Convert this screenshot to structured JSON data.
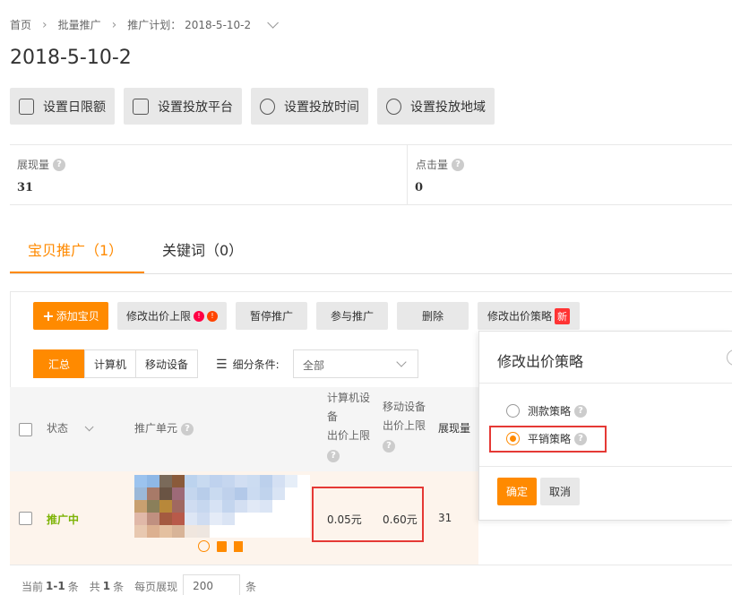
{
  "breadcrumb": {
    "home": "首页",
    "batch": "批量推广",
    "plan": "推广计划： 2018-5-10-2"
  },
  "page_title": "2018-5-10-2",
  "toolbar": {
    "daily_limit": "设置日限额",
    "platform": "设置投放平台",
    "time": "设置投放时间",
    "region": "设置投放地域"
  },
  "stats": {
    "impressions_label": "展现量",
    "impressions_value": "31",
    "clicks_label": "点击量",
    "clicks_value": "0"
  },
  "tabs": {
    "items": "宝贝推广（1）",
    "keywords": "关键词（0）"
  },
  "actions": {
    "add": "添加宝贝",
    "modify_bid": "修改出价上限",
    "pause": "暂停推广",
    "join": "参与推广",
    "delete": "删除",
    "bid_strategy": "修改出价策略",
    "new_badge": "新"
  },
  "segments": {
    "summary": "汇总",
    "computer": "计算机",
    "mobile": "移动设备"
  },
  "filter": {
    "label": "细分条件:",
    "value": "全部"
  },
  "table": {
    "col_status": "状态",
    "col_unit": "推广单元",
    "col_pc_bid_1": "计算机设",
    "col_pc_bid_2": "备",
    "col_pc_bid_3": "出价上限",
    "col_mobile_bid_1": "移动设备",
    "col_mobile_bid_2": "出价上限",
    "col_impressions": "展现量",
    "row": {
      "status": "推广中",
      "pc_bid": "0.05元",
      "mobile_bid": "0.60元",
      "impressions": "31"
    }
  },
  "footer": {
    "current": "当前",
    "range": "1-1",
    "unit1": "条",
    "total_label": "共",
    "total": "1",
    "unit2": "条",
    "per_page_label": "每页展现",
    "per_page": "200",
    "unit3": "条"
  },
  "popup": {
    "title": "修改出价策略",
    "option1": "测款策略",
    "option2": "平销策略",
    "confirm": "确定",
    "cancel": "取消"
  },
  "colors": {
    "accent": "#ff8a00",
    "status_green": "#7cb305",
    "highlight_red": "#e53935"
  }
}
